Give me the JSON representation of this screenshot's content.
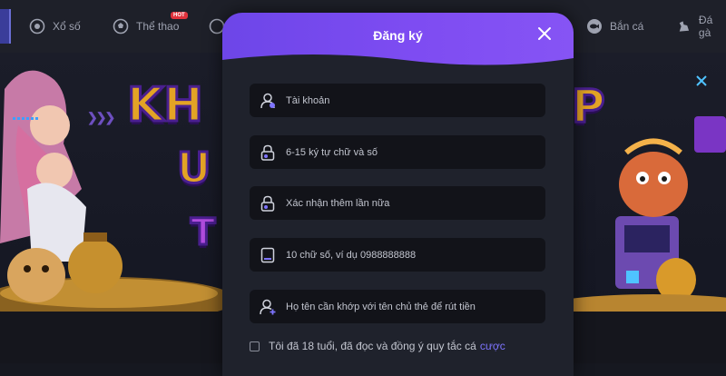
{
  "nav": {
    "items": [
      {
        "label": "Xổ số",
        "icon": "lottery-icon"
      },
      {
        "label": "Thể thao",
        "icon": "sports-icon",
        "badge": "HOT"
      },
      {
        "label": "Bắn cá",
        "icon": "fish-icon"
      },
      {
        "label": "Đá gà",
        "icon": "rooster-icon"
      }
    ]
  },
  "modal": {
    "title": "Đăng ký",
    "fields": [
      {
        "placeholder": "Tài khoản",
        "icon": "user-icon"
      },
      {
        "placeholder": "6-15 ký tự chữ và số",
        "icon": "lock-icon"
      },
      {
        "placeholder": "Xác nhận thêm lần nữa",
        "icon": "lock-icon"
      },
      {
        "placeholder": "10 chữ số, ví dụ 0988888888",
        "icon": "phone-icon"
      },
      {
        "placeholder": "Họ tên cần khớp với tên chủ thẻ để rút tiền",
        "icon": "add-user-icon"
      }
    ],
    "terms": {
      "text": "Tôi đã 18 tuổi, đã đọc và đồng ý quy tắc cá",
      "link": "cược"
    }
  },
  "colors": {
    "header_gradient_start": "#6d46e8",
    "header_gradient_end": "#8654f4",
    "link": "#7e74ff",
    "field_bg": "#121319",
    "modal_bg": "#1f222c"
  }
}
